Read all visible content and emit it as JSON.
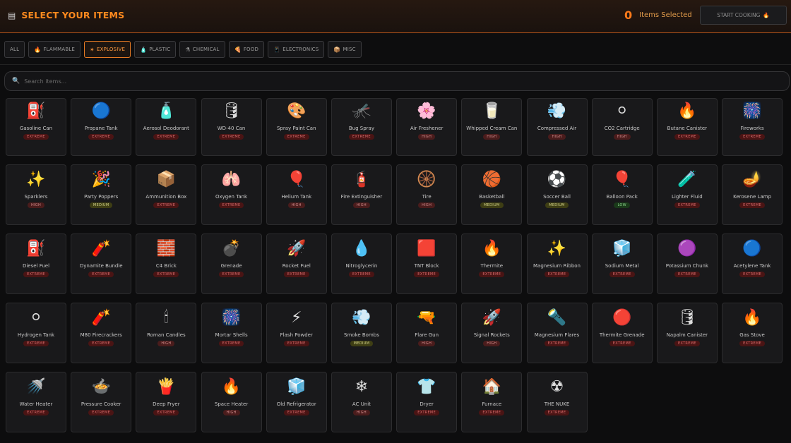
{
  "header": {
    "icon": "cart-icon",
    "title": "SELECT YOUR ITEMS",
    "selected_count": "0",
    "selected_label": "Items Selected",
    "start_button": "START COOKING",
    "start_icon": "fire-icon"
  },
  "filters": [
    {
      "label": "ALL",
      "icon": ""
    },
    {
      "label": "FLAMMABLE",
      "icon": "🔥"
    },
    {
      "label": "EXPLOSIVE",
      "icon": "✴"
    },
    {
      "label": "PLASTIC",
      "icon": "🧴"
    },
    {
      "label": "CHEMICAL",
      "icon": "⚗"
    },
    {
      "label": "FOOD",
      "icon": "🍕"
    },
    {
      "label": "ELECTRONICS",
      "icon": "📱"
    },
    {
      "label": "MISC",
      "icon": "📦"
    }
  ],
  "active_filter": "EXPLOSIVE",
  "search": {
    "placeholder": "Search items...",
    "value": "",
    "icon": "search-icon"
  },
  "badge_colors": {
    "extreme": "#d46a6a",
    "high": "#cf8a8a",
    "medium": "#d4d48a",
    "low": "#8ad48a"
  },
  "items": [
    {
      "name": "Gasoline Can",
      "icon": "⛽",
      "level": "EXTREME"
    },
    {
      "name": "Propane Tank",
      "icon": "🔵",
      "level": "EXTREME"
    },
    {
      "name": "Aerosol Deodorant",
      "icon": "🧴",
      "level": "EXTREME"
    },
    {
      "name": "WD-40 Can",
      "icon": "🛢",
      "level": "EXTREME"
    },
    {
      "name": "Spray Paint Can",
      "icon": "🎨",
      "level": "EXTREME"
    },
    {
      "name": "Bug Spray",
      "icon": "🦟",
      "level": "EXTREME"
    },
    {
      "name": "Air Freshener",
      "icon": "🌸",
      "level": "HIGH"
    },
    {
      "name": "Whipped Cream Can",
      "icon": "🥛",
      "level": "HIGH"
    },
    {
      "name": "Compressed Air",
      "icon": "💨",
      "level": "HIGH"
    },
    {
      "name": "CO2 Cartridge",
      "icon": "⚪",
      "level": "HIGH"
    },
    {
      "name": "Butane Canister",
      "icon": "🔥",
      "level": "EXTREME"
    },
    {
      "name": "Fireworks",
      "icon": "🎆",
      "level": "EXTREME"
    },
    {
      "name": "Sparklers",
      "icon": "✨",
      "level": "HIGH"
    },
    {
      "name": "Party Poppers",
      "icon": "🎉",
      "level": "MEDIUM"
    },
    {
      "name": "Ammunition Box",
      "icon": "📦",
      "level": "EXTREME"
    },
    {
      "name": "Oxygen Tank",
      "icon": "🫁",
      "level": "EXTREME"
    },
    {
      "name": "Helium Tank",
      "icon": "🎈",
      "level": "HIGH"
    },
    {
      "name": "Fire Extinguisher",
      "icon": "🧯",
      "level": "HIGH"
    },
    {
      "name": "Tire",
      "icon": "🛞",
      "level": "HIGH"
    },
    {
      "name": "Basketball",
      "icon": "🏀",
      "level": "MEDIUM"
    },
    {
      "name": "Soccer Ball",
      "icon": "⚽",
      "level": "MEDIUM"
    },
    {
      "name": "Balloon Pack",
      "icon": "🎈",
      "level": "LOW"
    },
    {
      "name": "Lighter Fluid",
      "icon": "🧪",
      "level": "EXTREME"
    },
    {
      "name": "Kerosene Lamp",
      "icon": "🪔",
      "level": "EXTREME"
    },
    {
      "name": "Diesel Fuel",
      "icon": "⛽",
      "level": "EXTREME"
    },
    {
      "name": "Dynamite Bundle",
      "icon": "🧨",
      "level": "EXTREME"
    },
    {
      "name": "C4 Brick",
      "icon": "🧱",
      "level": "EXTREME"
    },
    {
      "name": "Grenade",
      "icon": "💣",
      "level": "EXTREME"
    },
    {
      "name": "Rocket Fuel",
      "icon": "🚀",
      "level": "EXTREME"
    },
    {
      "name": "Nitroglycerin",
      "icon": "💧",
      "level": "EXTREME"
    },
    {
      "name": "TNT Block",
      "icon": "🟥",
      "level": "EXTREME"
    },
    {
      "name": "Thermite",
      "icon": "🔥",
      "level": "EXTREME"
    },
    {
      "name": "Magnesium Ribbon",
      "icon": "✨",
      "level": "EXTREME"
    },
    {
      "name": "Sodium Metal",
      "icon": "🧊",
      "level": "EXTREME"
    },
    {
      "name": "Potassium Chunk",
      "icon": "🟣",
      "level": "EXTREME"
    },
    {
      "name": "Acetylene Tank",
      "icon": "🔵",
      "level": "EXTREME"
    },
    {
      "name": "Hydrogen Tank",
      "icon": "⚪",
      "level": "EXTREME"
    },
    {
      "name": "M80 Firecrackers",
      "icon": "🧨",
      "level": "EXTREME"
    },
    {
      "name": "Roman Candles",
      "icon": "🕯",
      "level": "HIGH"
    },
    {
      "name": "Mortar Shells",
      "icon": "🎆",
      "level": "EXTREME"
    },
    {
      "name": "Flash Powder",
      "icon": "⚡",
      "level": "EXTREME"
    },
    {
      "name": "Smoke Bombs",
      "icon": "💨",
      "level": "MEDIUM"
    },
    {
      "name": "Flare Gun",
      "icon": "🔫",
      "level": "HIGH"
    },
    {
      "name": "Signal Rockets",
      "icon": "🚀",
      "level": "HIGH"
    },
    {
      "name": "Magnesium Flares",
      "icon": "🔦",
      "level": "EXTREME"
    },
    {
      "name": "Thermite Grenade",
      "icon": "🔴",
      "level": "EXTREME"
    },
    {
      "name": "Napalm Canister",
      "icon": "🛢",
      "level": "EXTREME"
    },
    {
      "name": "Gas Stove",
      "icon": "🔥",
      "level": "EXTREME"
    },
    {
      "name": "Water Heater",
      "icon": "🚿",
      "level": "EXTREME"
    },
    {
      "name": "Pressure Cooker",
      "icon": "🍲",
      "level": "EXTREME"
    },
    {
      "name": "Deep Fryer",
      "icon": "🍟",
      "level": "EXTREME"
    },
    {
      "name": "Space Heater",
      "icon": "🔥",
      "level": "HIGH"
    },
    {
      "name": "Old Refrigerator",
      "icon": "🧊",
      "level": "EXTREME"
    },
    {
      "name": "AC Unit",
      "icon": "❄",
      "level": "HIGH"
    },
    {
      "name": "Dryer",
      "icon": "👕",
      "level": "EXTREME"
    },
    {
      "name": "Furnace",
      "icon": "🏠",
      "level": "EXTREME"
    },
    {
      "name": "THE NUKE",
      "icon": "☢",
      "level": "EXTREME"
    }
  ]
}
